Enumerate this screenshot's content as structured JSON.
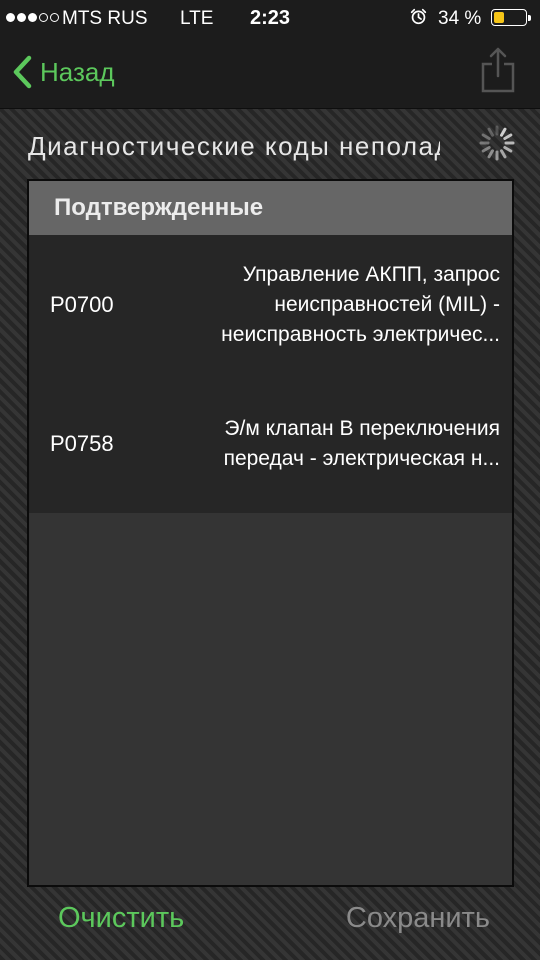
{
  "status_bar": {
    "carrier": "MTS RUS",
    "network": "LTE",
    "time": "2:23",
    "battery_percent": "34 %",
    "battery_level": 0.34,
    "signal_bars_filled": 3,
    "signal_bars_total": 5,
    "alarm_icon": "alarm-clock-icon"
  },
  "nav": {
    "back_label": "Назад",
    "back_icon": "chevron-left-icon",
    "share_icon": "share-icon"
  },
  "page": {
    "title": "Диагностические коды неполадок",
    "loading_icon": "activity-spinner-icon"
  },
  "section": {
    "header": "Подтвержденные"
  },
  "codes": [
    {
      "code": "P0700",
      "desc_lines": [
        "Управление АКПП, запрос",
        "неисправностей (MIL) -",
        "неисправность электричес..."
      ]
    },
    {
      "code": "P0758",
      "desc_lines": [
        "Э/м клапан B переключения",
        "передач - электрическая н..."
      ]
    }
  ],
  "footer": {
    "clear_label": "Очистить",
    "save_label": "Сохранить"
  },
  "colors": {
    "accent_green": "#5cc85c",
    "disabled_gray": "#8a8a8a",
    "battery_yellow": "#f5c518"
  }
}
